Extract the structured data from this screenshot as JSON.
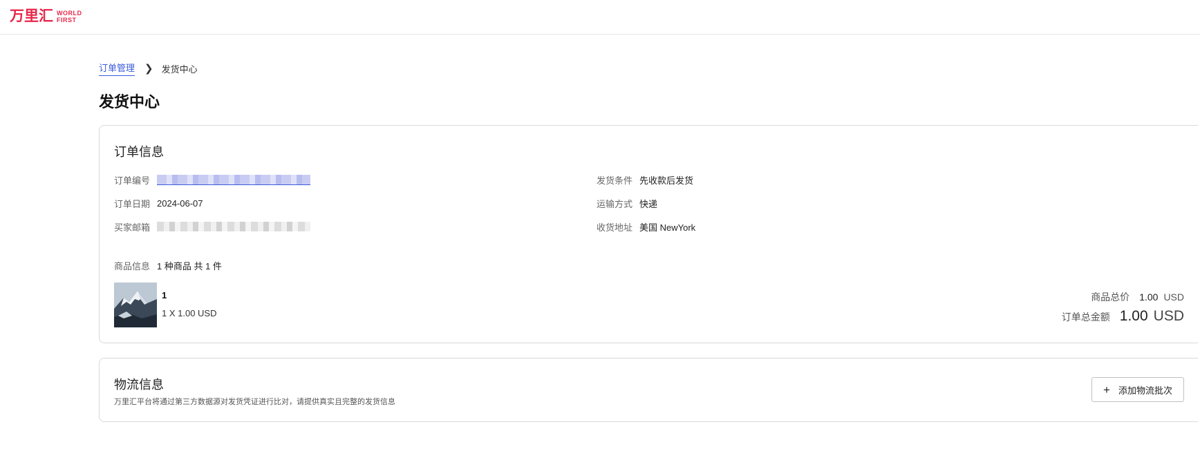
{
  "logo": {
    "cn": "万里汇",
    "en_line1": "WORLD",
    "en_line2": "FIRST"
  },
  "breadcrumb": {
    "parent": "订单管理",
    "separator": "❯",
    "current": "发货中心"
  },
  "page_title": "发货中心",
  "order_info": {
    "title": "订单信息",
    "left_fields": {
      "order_no_label": "订单编号",
      "order_date_label": "订单日期",
      "order_date_value": "2024-06-07",
      "buyer_email_label": "买家邮箱"
    },
    "right_fields": {
      "ship_condition_label": "发货条件",
      "ship_condition_value": "先收款后发货",
      "transport_label": "运输方式",
      "transport_value": "快递",
      "address_label": "收货地址",
      "address_value": "美国 NewYork"
    },
    "goods": {
      "label": "商品信息",
      "summary": "1 种商品 共 1 件",
      "item_name": "1",
      "item_qty": "1 X 1.00 USD"
    },
    "totals": {
      "goods_total_label": "商品总价",
      "goods_total_value": "1.00",
      "goods_total_currency": "USD",
      "order_total_label": "订单总金额",
      "order_total_value": "1.00",
      "order_total_currency": "USD"
    }
  },
  "logistics": {
    "title": "物流信息",
    "note": "万里汇平台将通过第三方数据源对发货凭证进行比对，请提供真实且完整的发货信息",
    "add_button": "添加物流批次",
    "add_icon": "plus-icon"
  }
}
